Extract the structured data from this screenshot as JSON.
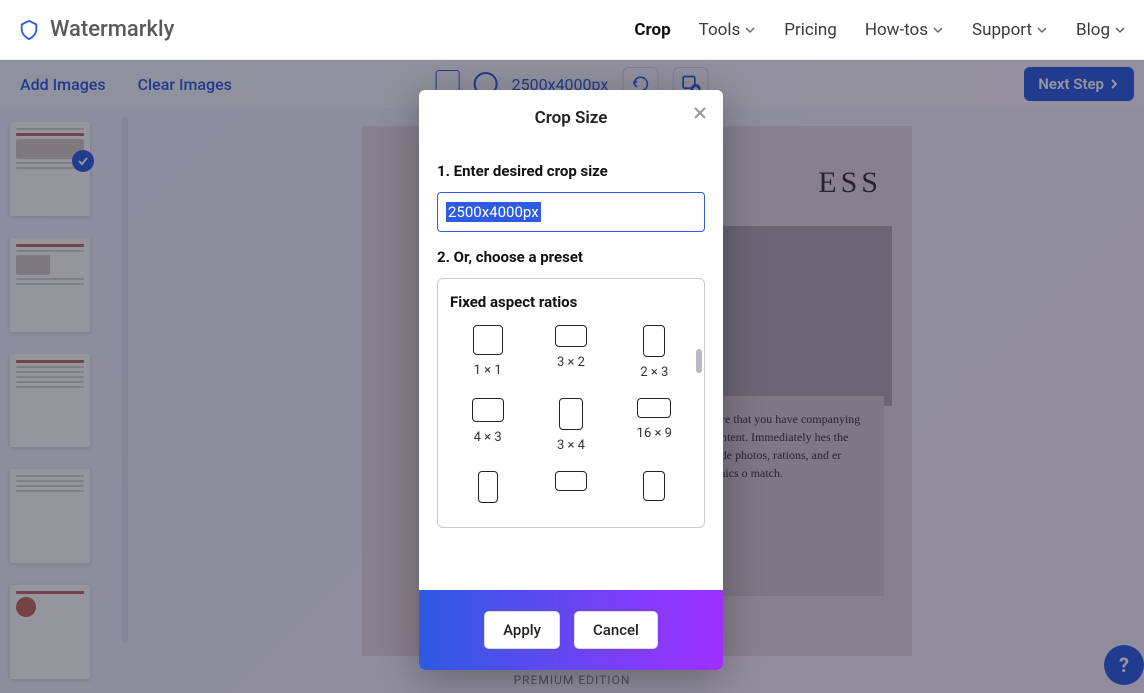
{
  "brand": "Watermarkly",
  "nav": {
    "crop": "Crop",
    "tools": "Tools",
    "pricing": "Pricing",
    "howtos": "How-tos",
    "support": "Support",
    "blog": "Blog"
  },
  "toolbar": {
    "add": "Add Images",
    "clear": "Clear Images",
    "dims": "2500x4000px",
    "next": "Next Step"
  },
  "doc": {
    "headline": "ESS",
    "body": "re sure that you have companying al content. Immediately hes the eye. de photos, rations, and er graphics o match."
  },
  "premium": "PREMIUM EDITION",
  "modal": {
    "title": "Crop Size",
    "step1": "1. Enter desired crop size",
    "input": "2500x4000px",
    "step2": "2. Or, choose a preset",
    "presetTitle": "Fixed aspect ratios",
    "ratios": [
      "1 × 1",
      "3 × 2",
      "2 × 3",
      "4 × 3",
      "3 × 4",
      "16 × 9"
    ],
    "apply": "Apply",
    "cancel": "Cancel"
  },
  "help": "?"
}
